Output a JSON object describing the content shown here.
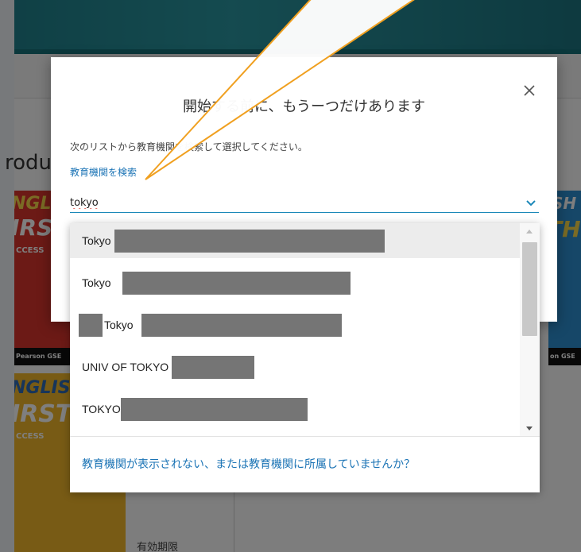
{
  "background_page": {
    "partial_heading": "rodu",
    "book_red": {
      "line1": "NGLISH",
      "line2": "IRST",
      "line3": "CCESS",
      "footer": "Pearson  GSE"
    },
    "book_blue": {
      "line1": "SH",
      "line2": "TH",
      "footer": "on  GSE"
    },
    "book_yellow": {
      "line1": "NGLISH",
      "line2": "IRSTH",
      "line3": "CCESS"
    },
    "expiry_label": "有効期限"
  },
  "modal": {
    "title": "開始する前に、もうーつだけあります",
    "close_symbol": "×",
    "instruction": "次のリストから教育機関を検索して選択してください。",
    "search_label": "教育機関を検索",
    "search_value": "tokyo"
  },
  "dropdown": {
    "items": [
      {
        "label": "Tokyo"
      },
      {
        "label": "Tokyo"
      },
      {
        "label": "Tokyo"
      },
      {
        "label": "UNIV OF TOKYO"
      },
      {
        "label": "TOKYO"
      }
    ],
    "footer_link": "教育機関が表示されない、または教育機関に所属していませんか？"
  },
  "colors": {
    "link": "#1a73b5",
    "callout_stroke": "#f0a020",
    "redaction": "#757575"
  }
}
